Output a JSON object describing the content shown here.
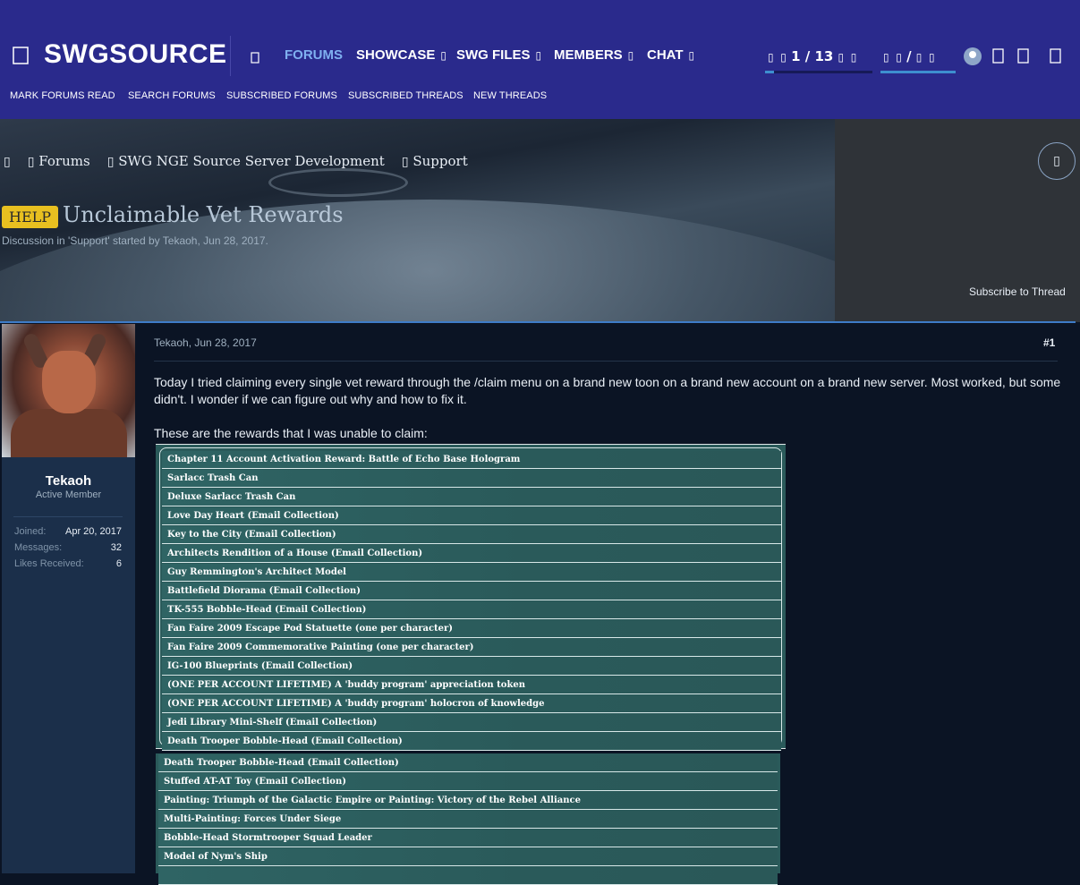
{
  "header": {
    "menu_icon": "hamburger-icon",
    "logo": "SWGSOURCE",
    "home_icon": "home-icon",
    "nav": [
      {
        "label": "FORUMS",
        "active": true,
        "has_caret": false
      },
      {
        "label": "SHOWCASE",
        "active": false,
        "has_caret": true
      },
      {
        "label": "SWG FILES",
        "active": false,
        "has_caret": true
      },
      {
        "label": "MEMBERS",
        "active": false,
        "has_caret": true
      },
      {
        "label": "CHAT",
        "active": false,
        "has_caret": true
      }
    ],
    "counter1": {
      "value": "1 / 13",
      "progress": 0.08
    },
    "counter2": {
      "value": "/",
      "progress": 0
    },
    "subnav": [
      "MARK FORUMS READ",
      "SEARCH FORUMS",
      "SUBSCRIBED FORUMS",
      "SUBSCRIBED THREADS",
      "NEW THREADS"
    ]
  },
  "breadcrumb": {
    "items": [
      "Forums",
      "SWG NGE Source Server Development",
      "Support"
    ]
  },
  "thread": {
    "prefix": "HELP",
    "title": "Unclaimable Vet Rewards",
    "meta": "Discussion in 'Support' started by Tekaoh, Jun 28, 2017.",
    "subscribe_label": "Subscribe to Thread"
  },
  "author": {
    "name": "Tekaoh",
    "title": "Active Member",
    "stats": [
      {
        "label": "Joined:",
        "value": "Apr 20, 2017"
      },
      {
        "label": "Messages:",
        "value": "32"
      },
      {
        "label": "Likes Received:",
        "value": "6"
      }
    ]
  },
  "post": {
    "author_date": "Tekaoh, Jun 28, 2017",
    "number": "#1",
    "paragraph1": "Today I tried claiming every single vet reward through the /claim menu on a brand new toon on a brand new account on a brand new server. Most worked, but some didn't. I wonder if we can figure out why and how to fix it.",
    "paragraph2": "These are the rewards that I was unable to claim:",
    "screenshot1": [
      "Chapter 11 Account Activation Reward: Battle of Echo Base Hologram",
      "Sarlacc Trash Can",
      "Deluxe Sarlacc Trash Can",
      "Love Day Heart (Email Collection)",
      "Key to the City (Email Collection)",
      "Architects Rendition of a House (Email Collection)",
      "Guy Remmington's Architect Model",
      "Battlefield Diorama (Email Collection)",
      "TK-555 Bobble-Head (Email Collection)",
      "Fan Faire 2009 Escape Pod Statuette (one per character)",
      "Fan Faire 2009 Commemorative Painting (one per character)",
      "IG-100 Blueprints (Email Collection)",
      "(ONE PER ACCOUNT LIFETIME) A 'buddy program' appreciation token",
      "(ONE PER ACCOUNT LIFETIME) A 'buddy program' holocron of knowledge",
      "Jedi Library Mini-Shelf (Email Collection)",
      "Death Trooper Bobble-Head (Email Collection)"
    ],
    "screenshot2": [
      "Death Trooper Bobble-Head (Email Collection)",
      "Stuffed AT-AT Toy (Email Collection)",
      "Painting: Triumph of the Galactic Empire or Painting: Victory of the Rebel Alliance",
      "Multi-Painting: Forces Under Siege",
      "Bobble-Head Stormtrooper Squad Leader",
      "Model of Nym's Ship",
      ""
    ]
  }
}
